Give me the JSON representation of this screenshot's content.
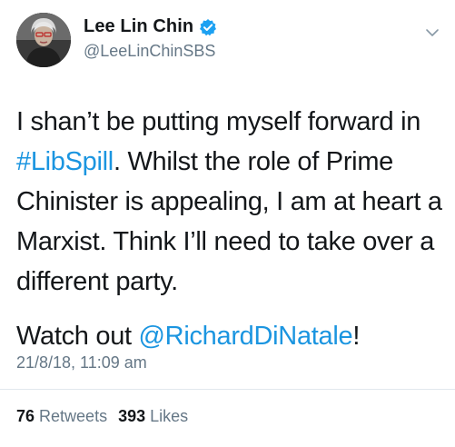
{
  "author": {
    "display_name": "Lee Lin Chin",
    "handle": "@LeeLinChinSBS",
    "verified": true
  },
  "tweet": {
    "line1_prefix": "I shan’t be putting myself forward in ",
    "hashtag": "#LibSpill",
    "line1_suffix": ". Whilst the role of Prime Chinister is appealing, I am at heart a Marxist. Think I’ll need to take over a different party.",
    "line2_prefix": "Watch out ",
    "mention": "@RichardDiNatale",
    "line2_suffix": "!"
  },
  "timestamp": "21/8/18, 11:09 am",
  "stats": {
    "retweets_count": "76",
    "retweets_label": "Retweets",
    "likes_count": "393",
    "likes_label": "Likes"
  },
  "colors": {
    "link": "#1b95e0",
    "secondary_text": "#657786",
    "verified": "#1da1f2"
  }
}
